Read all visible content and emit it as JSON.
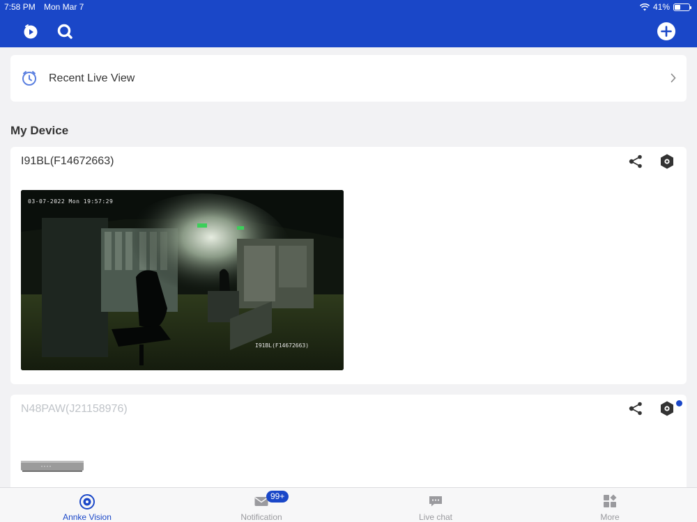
{
  "status_bar": {
    "time": "7:58 PM",
    "date": "Mon Mar 7",
    "battery": "41%"
  },
  "header": {
    "left_icons": [
      "playback-icon",
      "search-icon"
    ],
    "right_icon": "add-icon"
  },
  "recent": {
    "label": "Recent Live View",
    "icon": "clock-icon"
  },
  "section": {
    "title": "My Device"
  },
  "devices": [
    {
      "name": "I91BL(F14672663)",
      "preview": {
        "timestamp": "03-07-2022 Mon 19:57:29",
        "camera_label": "I91BL(F14672663)"
      }
    },
    {
      "name": "N48PAW(J21158976)",
      "has_update": true
    }
  ],
  "tabs": [
    {
      "label": "Annke Vision",
      "icon": "annke-vision-icon",
      "active": true
    },
    {
      "label": "Notification",
      "icon": "mail-icon",
      "badge": "99+"
    },
    {
      "label": "Live chat",
      "icon": "chat-icon"
    },
    {
      "label": "More",
      "icon": "more-grid-icon"
    }
  ],
  "colors": {
    "brand": "#1a47c8",
    "background": "#f2f2f4",
    "inactive": "#9a9a9e"
  }
}
